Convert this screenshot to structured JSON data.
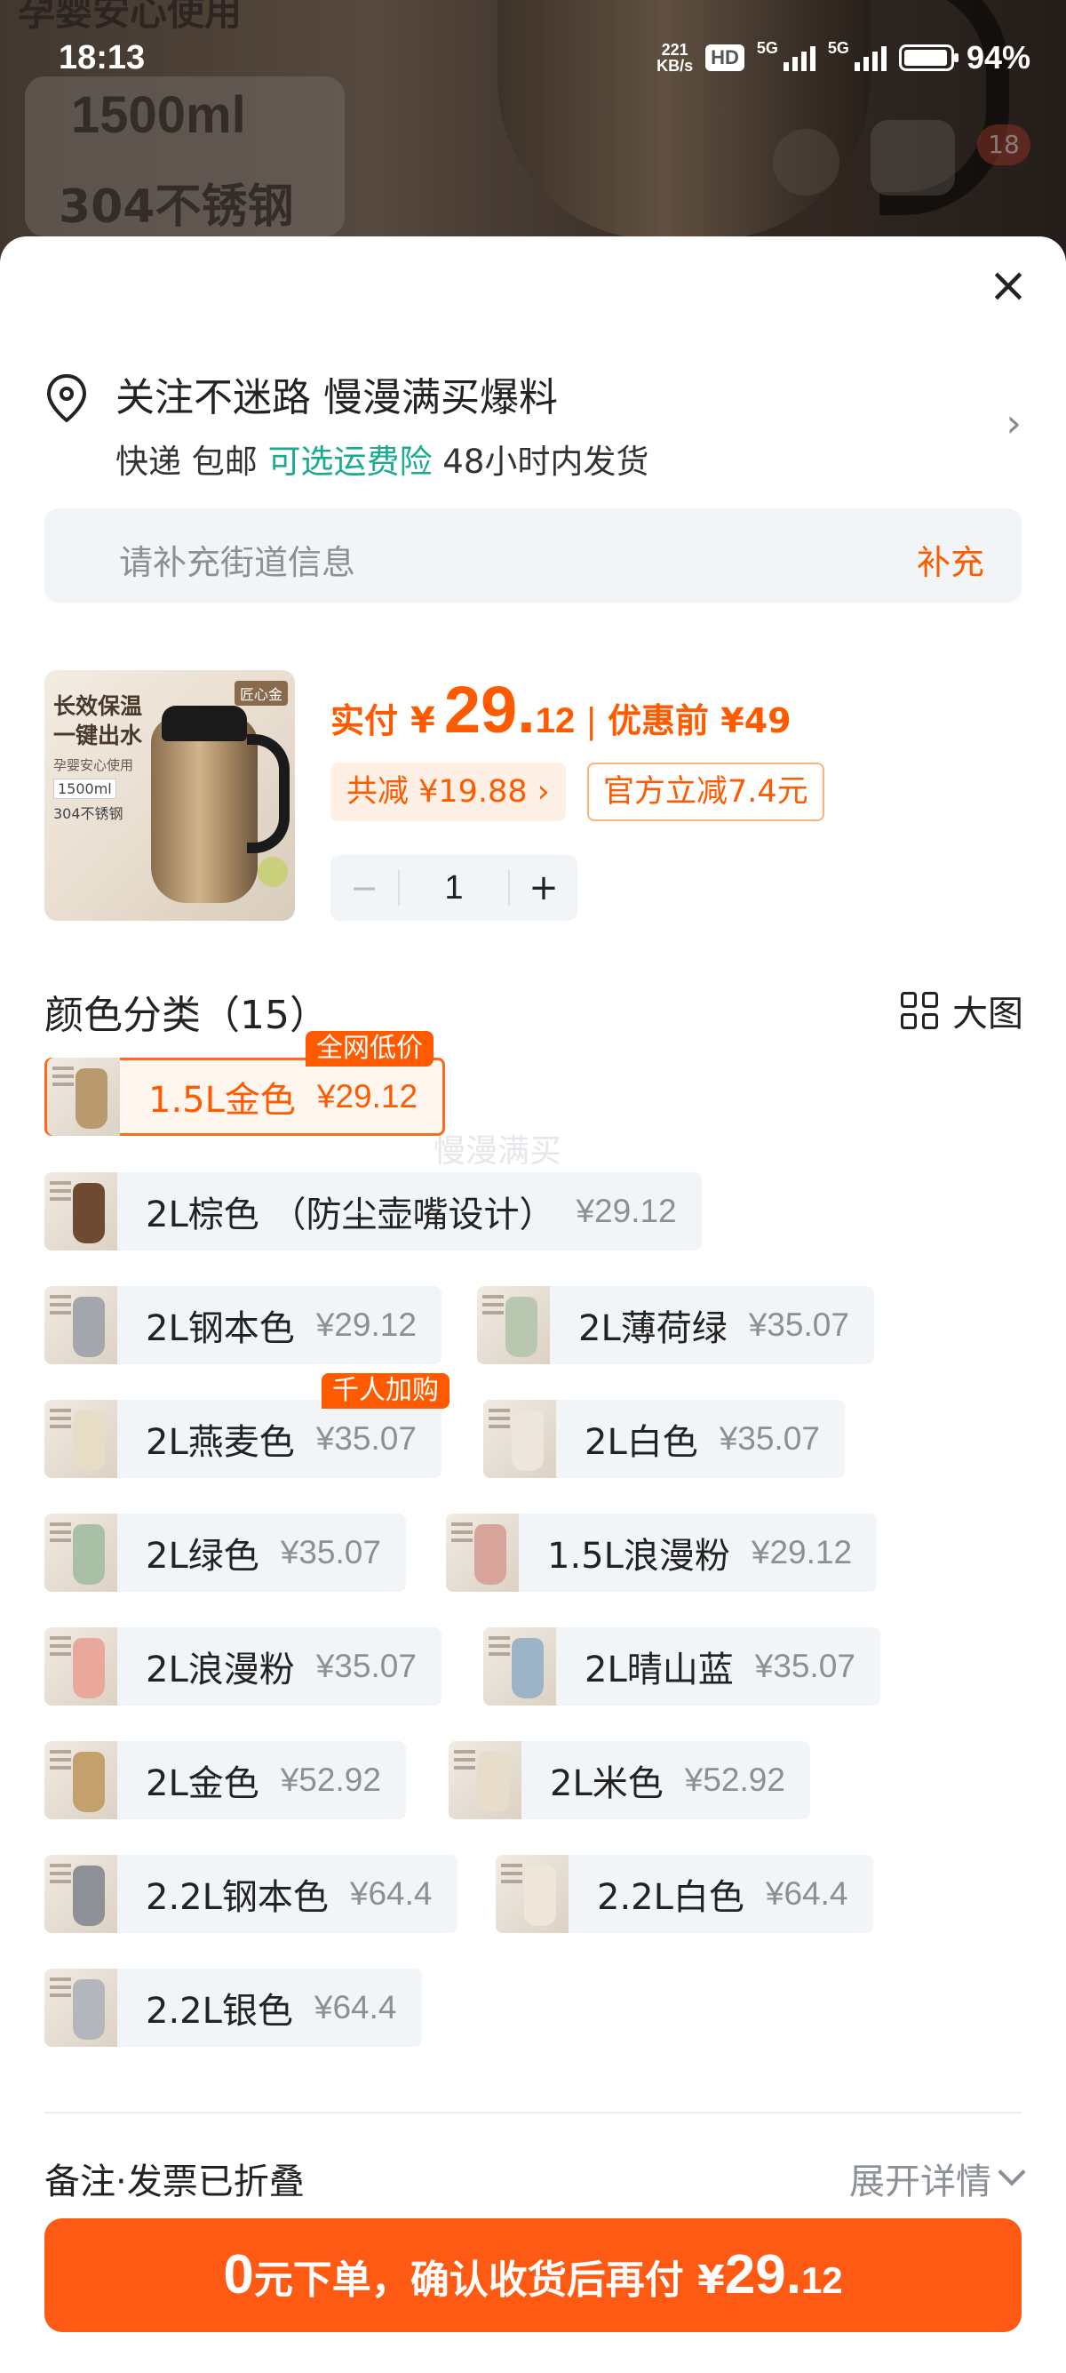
{
  "status_bar": {
    "time": "18:13",
    "net_speed_value": "221",
    "net_speed_unit": "KB/s",
    "hd": "HD",
    "signal_5g": "5G",
    "battery": "94%"
  },
  "backdrop": {
    "top_text": "孕婴安心使用",
    "capacity": "1500ml",
    "material": "304不锈钢",
    "cart_count": "18"
  },
  "sheet": {
    "close_icon": "×",
    "address": {
      "title": "关注不迷路 慢漫满买爆料",
      "shipping": "快递 包邮",
      "insurance": "可选运费险",
      "delivery": "48小时内发货",
      "street_placeholder": "请补充街道信息",
      "street_action": "补充"
    },
    "product": {
      "image_title": "长效保温 一键出水",
      "image_sub": "孕婴安心使用",
      "image_box1": "1500ml",
      "image_box2": "304不锈钢",
      "image_tag": "匠心金",
      "price_label": "实付",
      "yen": "¥",
      "price_int": "29.",
      "price_dec": "12",
      "separator": "|",
      "original_price": "优惠前 ¥49",
      "discount_total": "共减 ¥19.88 ›",
      "official_off": "官方立减7.4元",
      "qty_minus": "−",
      "qty": "1",
      "qty_plus": "+"
    },
    "colors": {
      "header": "颜色分类（15）",
      "big_image": "大图",
      "watermark": "慢漫满买",
      "items": [
        {
          "name": "1.5L金色",
          "price": "¥29.12",
          "badge": "全网低价"
        },
        {
          "name": "2L棕色 （防尘壶嘴设计）",
          "price": "¥29.12"
        },
        {
          "name": "2L钢本色",
          "price": "¥29.12"
        },
        {
          "name": "2L薄荷绿",
          "price": "¥35.07"
        },
        {
          "name": "2L燕麦色",
          "price": "¥35.07",
          "badge": "千人加购"
        },
        {
          "name": "2L白色",
          "price": "¥35.07"
        },
        {
          "name": "2L绿色",
          "price": "¥35.07"
        },
        {
          "name": "1.5L浪漫粉",
          "price": "¥29.12"
        },
        {
          "name": "2L浪漫粉",
          "price": "¥35.07"
        },
        {
          "name": "2L晴山蓝",
          "price": "¥35.07"
        },
        {
          "name": "2L金色",
          "price": "¥52.92"
        },
        {
          "name": "2L米色",
          "price": "¥52.92"
        },
        {
          "name": "2.2L钢本色",
          "price": "¥64.4"
        },
        {
          "name": "2.2L白色",
          "price": "¥64.4"
        },
        {
          "name": "2.2L银色",
          "price": "¥64.4"
        }
      ]
    },
    "remark": "备注·发票已折叠",
    "expand": "展开详情",
    "order_button": {
      "zero": "0",
      "text1": "元下单，确认收货后再付 ¥",
      "amount_int": "29.",
      "amount_dec": "12"
    }
  },
  "theme": {
    "accent": "#ff5a00",
    "green": "#1aaa8f",
    "chip_bg": "#f2f5f8"
  }
}
